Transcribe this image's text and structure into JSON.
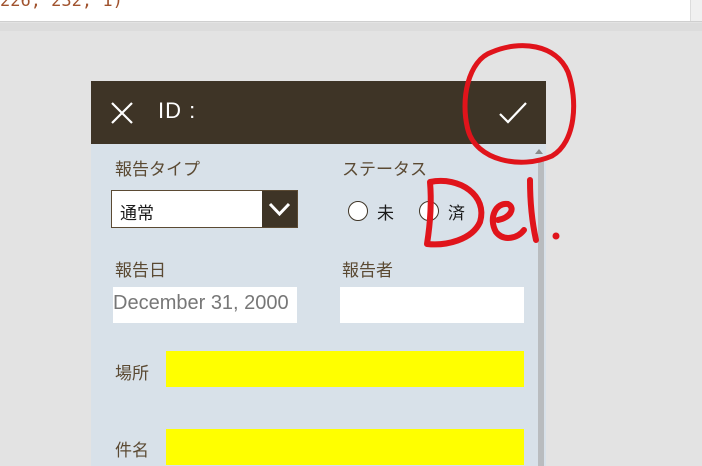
{
  "code_snippet": "226, 232, 1)",
  "form": {
    "title": "ID :",
    "report_type_label": "報告タイプ",
    "report_type_value": "通常",
    "status_label": "ステータス",
    "status_options": [
      "未",
      "済"
    ],
    "report_date_label": "報告日",
    "report_date_value": "December 31, 2000",
    "reporter_label": "報告者",
    "reporter_value": "",
    "location_label": "場所",
    "subject_label": "件名"
  },
  "annotation": {
    "text": "Del.",
    "color": "#e0141b"
  },
  "colors": {
    "header": "#3e3426",
    "panel": "#d8e1e9",
    "highlight": "#ffff00",
    "label": "#5b4a33"
  }
}
